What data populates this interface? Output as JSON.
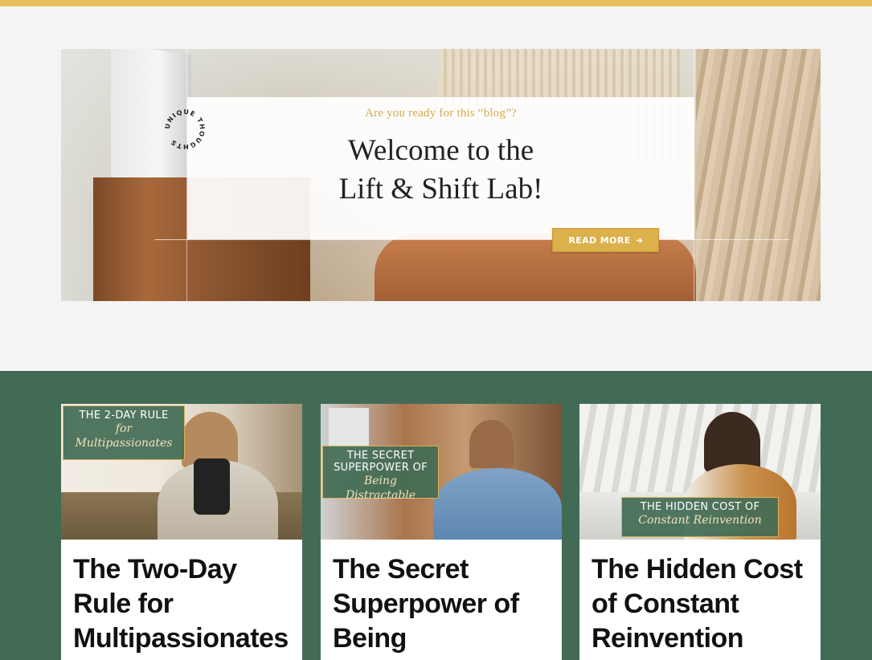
{
  "colors": {
    "accent_gold": "#e8bd5c",
    "button_gold": "#dcb04a",
    "section_green": "#426b55",
    "eyebrow_gold": "#d7a94a"
  },
  "hero": {
    "badge_text": "UNIQUE THOUGHTS",
    "eyebrow": "Are you ready for this “blog”?",
    "title_line1": "Welcome to the",
    "title_line2": "Lift & Shift Lab!",
    "cta_label": "READ MORE",
    "cta_icon": "arrow-right-icon"
  },
  "posts": [
    {
      "title": "The Two-Day Rule for Multipassionates",
      "tag_top": "THE 2-DAY RULE",
      "tag_script_1": "for",
      "tag_script_2": "Multipassionates"
    },
    {
      "title": "The Secret Superpower of Being",
      "tag_top_1": "THE SECRET",
      "tag_top_2": "SUPERPOWER OF",
      "tag_script": "Being Distractable"
    },
    {
      "title": "The Hidden Cost of Constant Reinvention",
      "tag_top": "THE HIDDEN COST OF",
      "tag_script": "Constant Reinvention"
    }
  ]
}
